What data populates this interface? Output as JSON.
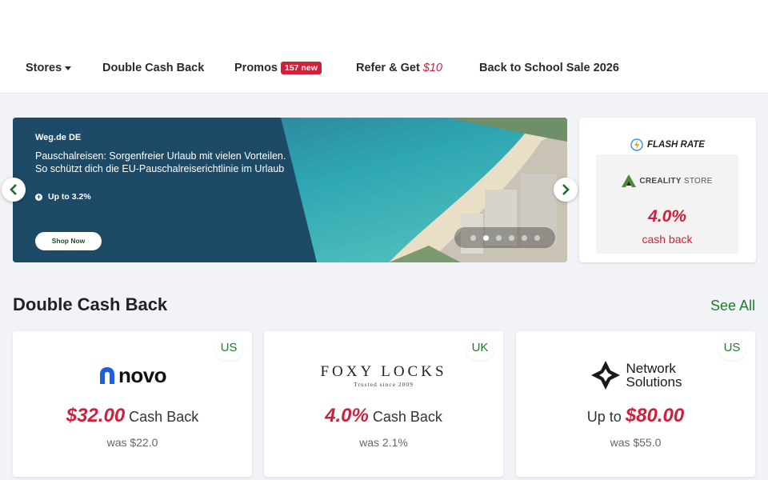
{
  "nav": {
    "stores": "Stores",
    "double_cash_back": "Double Cash Back",
    "promos": "Promos",
    "promos_badge": "157 new",
    "refer": "Refer & Get",
    "refer_amount": "$10",
    "back_to_school": "Back to School Sale 2026"
  },
  "hero": {
    "store": "Weg.de DE",
    "description": "Pauschalreisen: Sorgenfreier Urlaub mit vielen Vorteilen. So schützt dich die EU-Pauschalreiserichtlinie im Urlaub",
    "rate": "Up to 3.2%",
    "button": "Shop Now",
    "slide_count": 6,
    "active_slide": 2
  },
  "flash": {
    "label": "FLASH RATE",
    "store_logo_text": "CREALITY",
    "store_logo_suffix": "STORE",
    "rate": "4.0%",
    "unit": "cash back"
  },
  "section": {
    "title": "Double Cash Back",
    "see_all": "See All"
  },
  "cards": [
    {
      "region": "US",
      "logo": "novo",
      "prefix": "",
      "amount": "$32.00",
      "suffix": " Cash Back",
      "was": "was $22.0"
    },
    {
      "region": "UK",
      "logo": "FOXY LOCKS",
      "logo_tagline": "Trusted since 2009",
      "prefix": "",
      "amount": "4.0%",
      "suffix": " Cash Back",
      "was": "was 2.1%"
    },
    {
      "region": "US",
      "logo": "Network Solutions",
      "logo_line1": "Network",
      "logo_line2": "Solutions",
      "prefix": "Up to ",
      "amount": "$80.00",
      "suffix": "",
      "was": "was $55.0"
    }
  ],
  "colors": {
    "accent_red": "#d0213c",
    "accent_green": "#1e7c2c",
    "hero_panel": "#1d4a66"
  }
}
